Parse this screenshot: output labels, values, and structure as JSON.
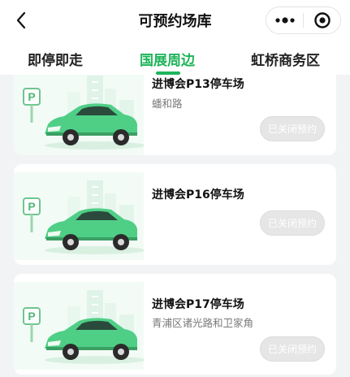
{
  "nav": {
    "title": "可预约场库"
  },
  "tabs": [
    {
      "label": "即停即走"
    },
    {
      "label": "国展周边"
    },
    {
      "label": "虹桥商务区"
    }
  ],
  "colors": {
    "accent": "#1fb45a",
    "car": "#4fcf86",
    "disabled_button": "#e6e6e6"
  },
  "icons": {
    "back": "chevron-left-icon",
    "more": "more-dots-icon",
    "close": "target-close-icon",
    "parking": "parking-p-icon"
  },
  "lots": [
    {
      "name": "进博会P13停车场",
      "address": "蟠和路",
      "button": "已关闭预约"
    },
    {
      "name": "进博会P16停车场",
      "address": "",
      "button": "已关闭预约"
    },
    {
      "name": "进博会P17停车场",
      "address": "青浦区诸光路和卫家角",
      "button": "已关闭预约"
    }
  ]
}
